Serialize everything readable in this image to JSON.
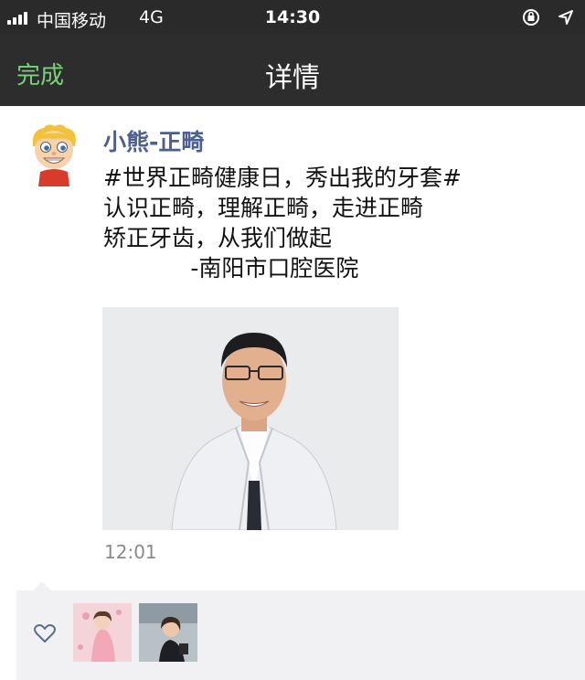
{
  "status_bar": {
    "carrier": "中国移动",
    "network": "4G",
    "time": "14:30"
  },
  "nav": {
    "done_label": "完成",
    "title": "详情"
  },
  "post": {
    "username": "小熊-正畸",
    "text_lines": [
      "#世界正畸健康日，秀出我的牙套#",
      "认识正畸，理解正畸，走进正畸",
      "矫正牙齿，从我们做起",
      "            -南阳市口腔医院"
    ],
    "time": "12:01"
  },
  "colors": {
    "accent_green": "#7bd07b",
    "username_blue": "#4d5f8f",
    "nav_bg": "#2d2d2d",
    "likes_bg": "#f1f1f3"
  },
  "icons": [
    "signal-icon",
    "rotation-lock-icon",
    "location-icon",
    "heart-icon"
  ]
}
